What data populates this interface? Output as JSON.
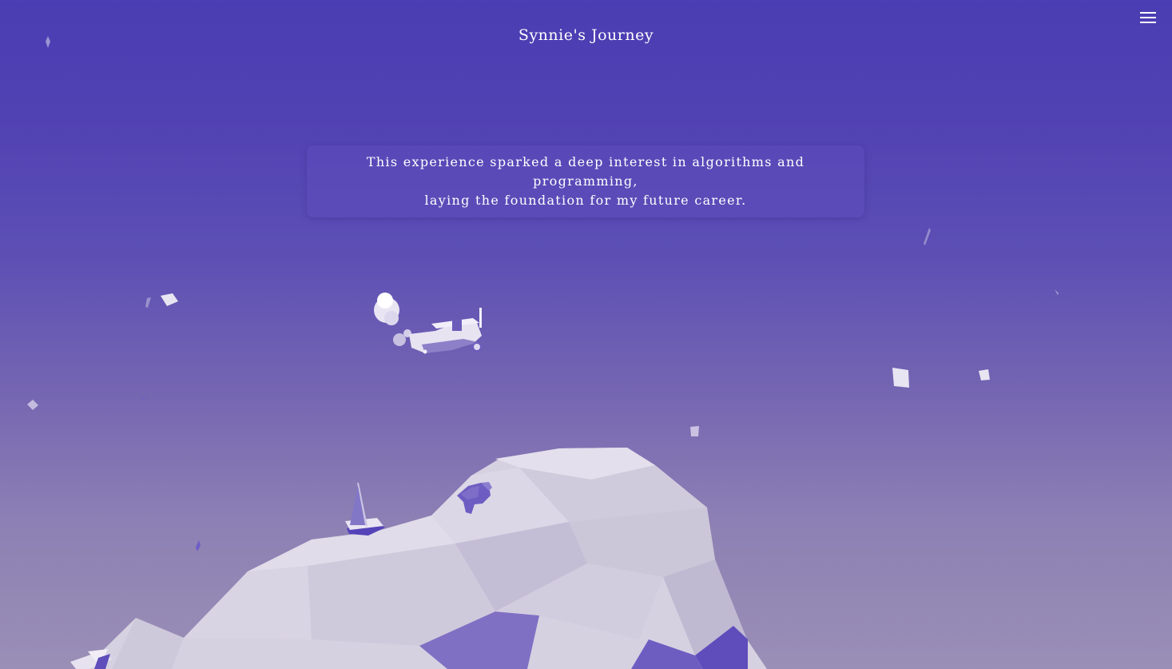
{
  "header": {
    "title": "Synnie's Journey",
    "menu_icon": "hamburger-menu-icon"
  },
  "story": {
    "text_line_1": "This experience sparked a deep interest in algorithms and programming,",
    "text_line_2": "laying the foundation for my future career."
  },
  "scene": {
    "elements": [
      "biplane",
      "bear",
      "sailboat",
      "low-poly-island",
      "floating-shards"
    ]
  },
  "colors": {
    "sky_top": "#4a3db3",
    "sky_bottom": "#9a8fb6",
    "island": "#d8d3e3",
    "accent": "#5a4cc0"
  }
}
